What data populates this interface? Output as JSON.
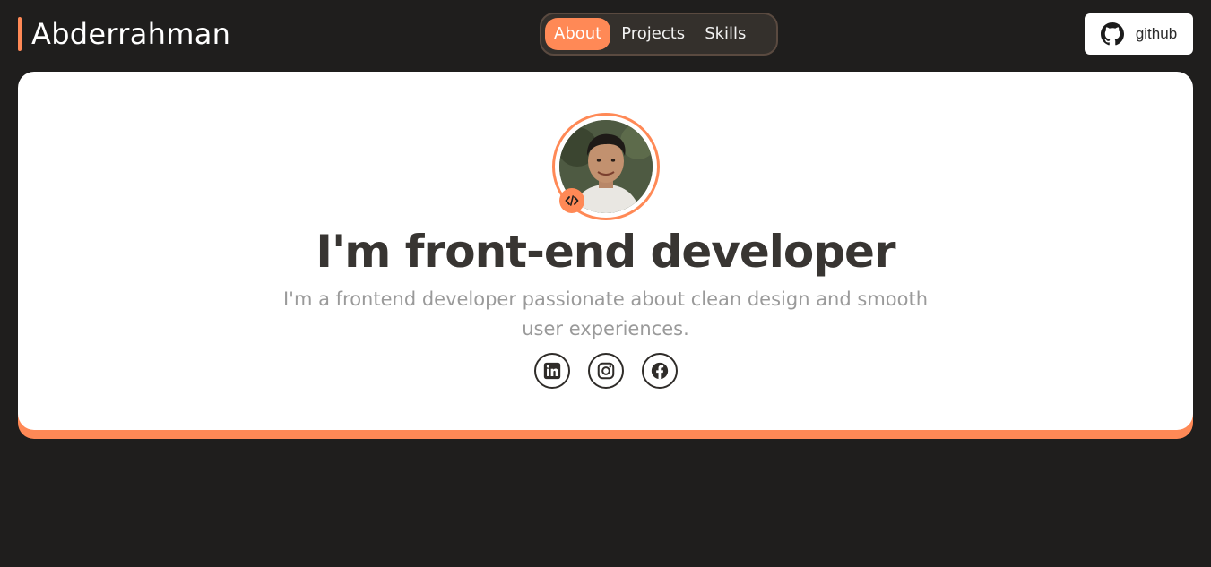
{
  "brand": {
    "name": "Abderrahman",
    "accent": "#ff8956"
  },
  "nav": {
    "items": [
      {
        "label": "About",
        "active": true
      },
      {
        "label": "Projects",
        "active": false
      },
      {
        "label": "Skills",
        "active": false
      }
    ]
  },
  "github": {
    "label": "github",
    "icon": "github-icon"
  },
  "hero": {
    "avatar_icon": "profile-photo",
    "badge_icon": "code-icon",
    "title": "I'm front-end developer",
    "subtitle": "I'm a frontend developer passionate about clean design and smooth user experiences."
  },
  "socials": [
    {
      "icon": "linkedin-icon"
    },
    {
      "icon": "instagram-icon"
    },
    {
      "icon": "facebook-icon"
    }
  ],
  "colors": {
    "background": "#1f1e1d",
    "accent": "#ff8956",
    "card": "#ffffff",
    "title": "#383532",
    "subtitle": "#9a9a9a"
  }
}
